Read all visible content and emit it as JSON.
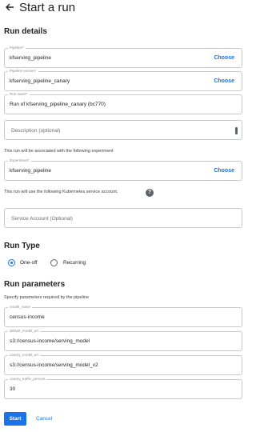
{
  "header": {
    "title": "Start a run",
    "back_icon": "arrow-left-icon"
  },
  "run_details": {
    "title": "Run details",
    "pipeline": {
      "label": "Pipeline*",
      "value": "kfserving_pipeline",
      "action": "Choose"
    },
    "pipeline_version": {
      "label": "Pipeline version*",
      "value": "kfserving_pipeline_canary",
      "action": "Choose"
    },
    "run_name": {
      "label": "Run name*",
      "value": "Run of kfserving_pipeline_canary (bc770)"
    },
    "description": {
      "placeholder": "Description (optional)"
    },
    "experiment_helper": "This run will be associated with the following experiment",
    "experiment": {
      "label": "Experiment*",
      "value": "kfserving_pipeline",
      "action": "Choose"
    },
    "service_account_helper": "This run will use the following Kubernetes service account.",
    "help_icon": "help-circle-icon",
    "service_account": {
      "placeholder": "Service Account (Optional)"
    }
  },
  "run_type": {
    "title": "Run Type",
    "options": [
      {
        "label": "One-off",
        "selected": true
      },
      {
        "label": "Recurring",
        "selected": false
      }
    ]
  },
  "run_parameters": {
    "title": "Run parameters",
    "helper": "Specify parameters required by the pipeline",
    "params": [
      {
        "label": "model_name",
        "value": "census-income"
      },
      {
        "label": "default_model_uri",
        "value": "s3://census-income/serving_model"
      },
      {
        "label": "canary_model_uri",
        "value": "s3://census-income/serving_model_v2"
      },
      {
        "label": "canary_traffic_percent",
        "value": "30"
      }
    ]
  },
  "actions": {
    "start": "Start",
    "cancel": "Cancel"
  },
  "colors": {
    "accent": "#1a73e8",
    "border": "#c7c9cc",
    "text": "#202124"
  }
}
